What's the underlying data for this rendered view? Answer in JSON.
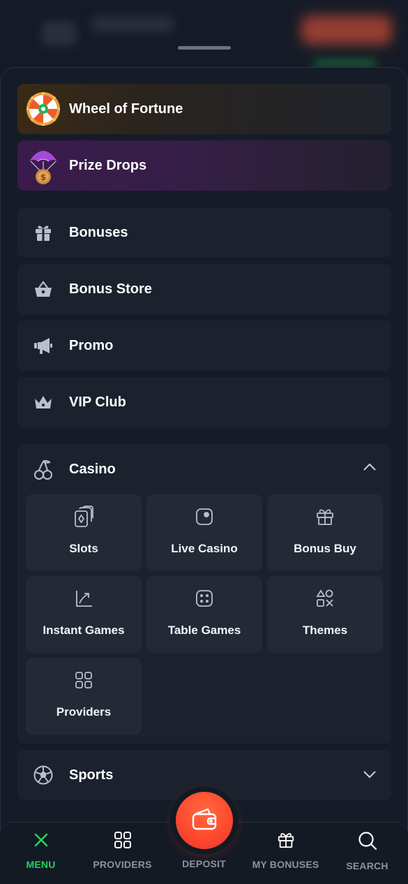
{
  "promos": [
    {
      "label": "Wheel of Fortune",
      "icon": "wheel-of-fortune-icon"
    },
    {
      "label": "Prize Drops",
      "icon": "prize-drops-icon"
    }
  ],
  "menu": [
    {
      "label": "Bonuses",
      "icon": "gift-icon"
    },
    {
      "label": "Bonus Store",
      "icon": "shopping-basket-icon"
    },
    {
      "label": "Promo",
      "icon": "megaphone-icon"
    },
    {
      "label": "VIP Club",
      "icon": "crown-icon"
    }
  ],
  "casino": {
    "label": "Casino",
    "icon": "cherries-icon",
    "expanded": true,
    "items": [
      {
        "label": "Slots",
        "icon": "cards-icon"
      },
      {
        "label": "Live Casino",
        "icon": "live-camera-icon"
      },
      {
        "label": "Bonus Buy",
        "icon": "gift-outline-icon"
      },
      {
        "label": "Instant Games",
        "icon": "chart-arrow-icon"
      },
      {
        "label": "Table Games",
        "icon": "dice-icon"
      },
      {
        "label": "Themes",
        "icon": "shapes-icon"
      },
      {
        "label": "Providers",
        "icon": "grid-icon"
      }
    ]
  },
  "sports": {
    "label": "Sports",
    "icon": "soccer-ball-icon",
    "expanded": false
  },
  "bottom_nav": [
    {
      "label": "MENU",
      "icon": "close-icon",
      "active": true
    },
    {
      "label": "PROVIDERS",
      "icon": "grid-icon",
      "active": false
    },
    {
      "label": "DEPOSIT",
      "icon": "wallet-icon",
      "active": false
    },
    {
      "label": "MY BONUSES",
      "icon": "gift-icon",
      "active": false
    },
    {
      "label": "SEARCH",
      "icon": "search-icon",
      "active": false
    }
  ],
  "colors": {
    "background": "#111722",
    "card": "#1c222d",
    "tile": "#232a36",
    "accent_green": "#27d160",
    "deposit_orange": "#ff4a2f",
    "muted_text": "#8b93a1"
  }
}
